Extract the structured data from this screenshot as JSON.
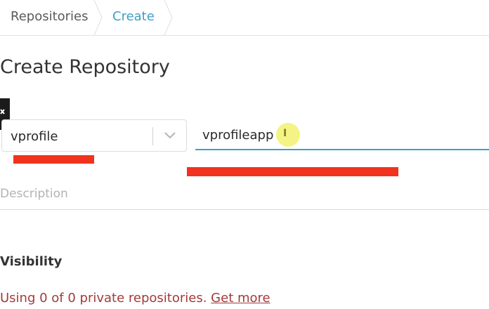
{
  "breadcrumb": {
    "items": [
      {
        "label": "Repositories"
      },
      {
        "label": "Create"
      }
    ]
  },
  "page": {
    "title": "Create Repository"
  },
  "form": {
    "namespace": {
      "value": "vprofile"
    },
    "repo_name": {
      "value": "vprofileapp"
    },
    "description": {
      "placeholder": "Description"
    },
    "visibility": {
      "label": "Visibility",
      "usage_text": "Using 0 of 0 private repositories.",
      "get_more_label": "Get more"
    }
  },
  "colors": {
    "accent": "#3d9fc6",
    "annotation_red": "#f0321e",
    "warning_text": "#a33a3a"
  }
}
